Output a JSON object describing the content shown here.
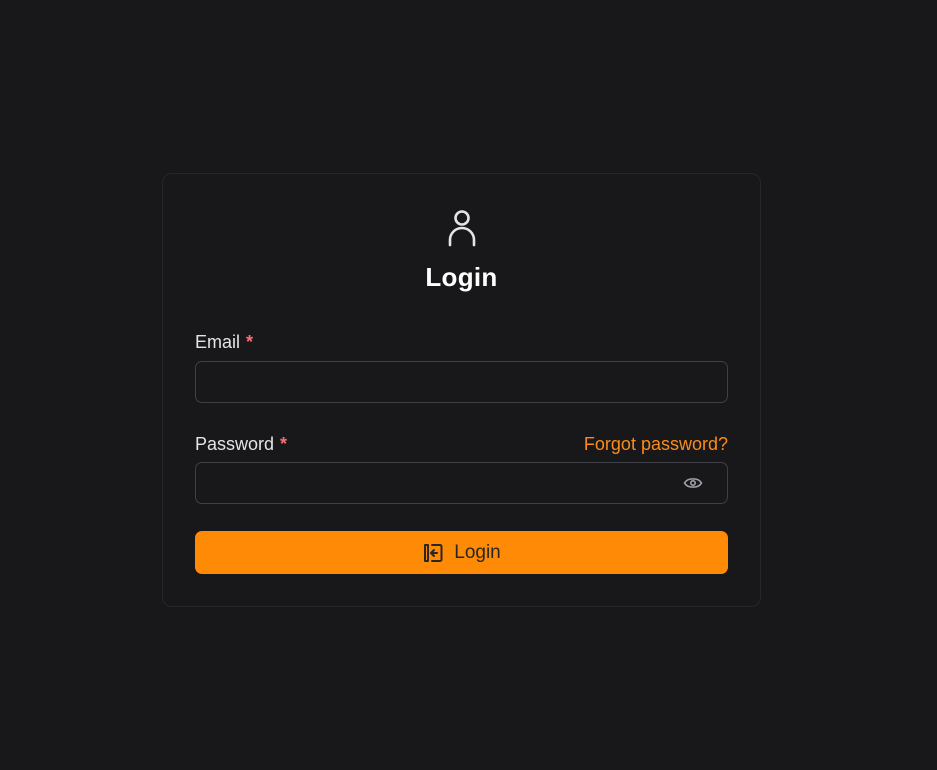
{
  "login": {
    "title": "Login",
    "email_label": "Email",
    "email_required": "*",
    "email_value": "",
    "password_label": "Password",
    "password_required": "*",
    "password_value": "",
    "forgot_password": "Forgot password?",
    "submit_label": "Login"
  },
  "icons": {
    "header": "user-icon",
    "password_toggle": "eye-icon",
    "submit": "login-arrow-icon"
  },
  "colors": {
    "background": "#18181b",
    "accent": "#ff8a05",
    "required": "#f87171",
    "border": "#3f3f46"
  }
}
